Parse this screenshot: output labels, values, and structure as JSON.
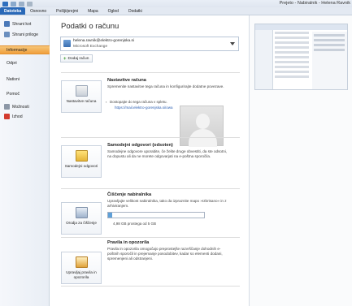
{
  "window": {
    "title": "Prejeto - Nabiralnik - Helena Ravnik"
  },
  "ribbon": {
    "tabs": [
      "Datoteka",
      "Osnovno",
      "Pošlji/prejmi",
      "Mapa",
      "Ogled",
      "Dodatki"
    ]
  },
  "sidebar": {
    "items": [
      {
        "label": "Shrani kot",
        "icon": "save-icon"
      },
      {
        "label": "Shrani priloge",
        "icon": "attachment-icon"
      },
      {
        "label": "Informacije"
      },
      {
        "label": "Odpri"
      },
      {
        "label": "Natisni"
      },
      {
        "label": "Pomoč"
      },
      {
        "label": "Možnosti",
        "icon": "options-icon"
      },
      {
        "label": "Izhod",
        "icon": "exit-icon"
      }
    ]
  },
  "main": {
    "title": "Podatki o računu",
    "account": {
      "email": "helena.ravnik@elektro-gorenjska.si",
      "type": "Microsoft Exchange"
    },
    "add_account_label": "Dodaj račun",
    "sections": [
      {
        "tile_label": "Nastavitve računa",
        "heading": "Nastavitve računa",
        "desc": "Spremenite nastavitve tega računa in konfigurirajte dodatne povezave.",
        "bullet": "Dostopajte do tega računa v spletu.",
        "link": "https://mail.elektro-gorenjska.si/owa"
      },
      {
        "tile_label": "Samodejni odgovori",
        "heading": "Samodejni odgovori (odsoten)",
        "desc": "Samodejne odgovore uporabite, če želite druge obvestiti, da ste odsotni, na dopustu ali da ne morete odgovarjati na e-poštna sporočila."
      },
      {
        "tile_label": "Orodja za čiščenje",
        "heading": "Čiščenje nabiralnika",
        "desc": "Upravljajte velikost nabiralnika, tako da izpraznite mapo »Izbrisano« in z arhiviranjem.",
        "storage_text": "4,98 GB prostega od 5 GB",
        "storage_used_fraction": 0.04
      },
      {
        "tile_label": "Upravljaj pravila in opozorila",
        "heading": "Pravila in opozorila",
        "desc": "Pravila in opozorila omogočajo preprostejše razvrščanje dohodnih e-poštnih sporočil in prejemanje posodobitev, kadar so elementi dodani, spremenjeni ali odstranjeni."
      }
    ]
  },
  "colors": {
    "file_tab": "#2a69b8",
    "active_sidebar": "#f0a03c",
    "link": "#2b5fb3",
    "storage_fill": "#5fa0d8"
  }
}
